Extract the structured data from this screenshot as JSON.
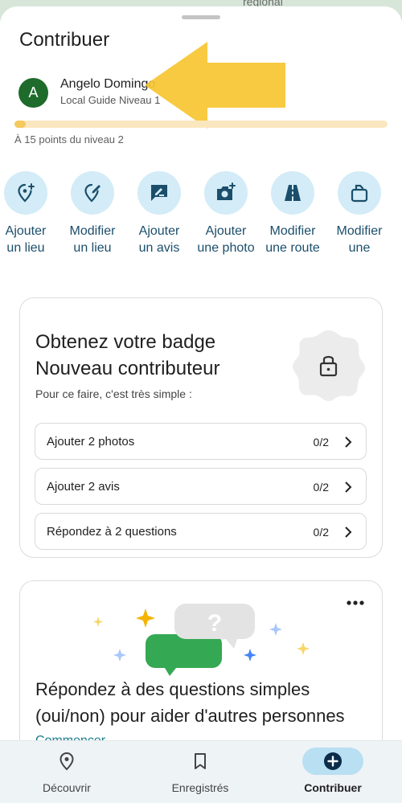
{
  "map": {
    "label": "régional"
  },
  "sheet": {
    "title": "Contribuer"
  },
  "user": {
    "initial": "A",
    "name": "Angelo Domingo",
    "level": "Local Guide Niveau 1",
    "progress_fraction": 0.03,
    "progress_text": "À 15 points du niveau 2"
  },
  "actions": [
    {
      "line1": "Ajouter",
      "line2": "un lieu",
      "icon": "add-location-icon"
    },
    {
      "line1": "Modifier",
      "line2": "un lieu",
      "icon": "edit-location-icon"
    },
    {
      "line1": "Ajouter",
      "line2": "un avis",
      "icon": "rate-review-icon"
    },
    {
      "line1": "Ajouter",
      "line2": "une photo",
      "icon": "add-photo-icon"
    },
    {
      "line1": "Modifier",
      "line2": "une route",
      "icon": "road-icon"
    },
    {
      "line1": "Modifier",
      "line2": "une",
      "icon": "edit-map-icon"
    }
  ],
  "badge": {
    "title": "Obtenez votre badge Nouveau contributeur",
    "subtitle": "Pour ce faire, c'est très simple :",
    "tasks": [
      {
        "label": "Ajouter 2 photos",
        "count": "0/2"
      },
      {
        "label": "Ajouter 2 avis",
        "count": "0/2"
      },
      {
        "label": "Répondez à 2 questions",
        "count": "0/2"
      }
    ]
  },
  "questions": {
    "title": "Répondez à des questions simples (oui/non) pour aider d'autres personnes",
    "link": "Commencer",
    "illustration_glyph": "?"
  },
  "nav": [
    {
      "label": "Découvrir",
      "icon": "location-pin-icon",
      "active": false
    },
    {
      "label": "Enregistrés",
      "icon": "bookmark-icon",
      "active": false
    },
    {
      "label": "Contribuer",
      "icon": "add-circle-icon",
      "active": true
    }
  ],
  "colors": {
    "accent": "#1a7e8c",
    "action_bg": "#d3ecf7",
    "avatar": "#1e6b2c",
    "highlight_arrow": "#f7c531",
    "progress": "#f4c95d"
  }
}
